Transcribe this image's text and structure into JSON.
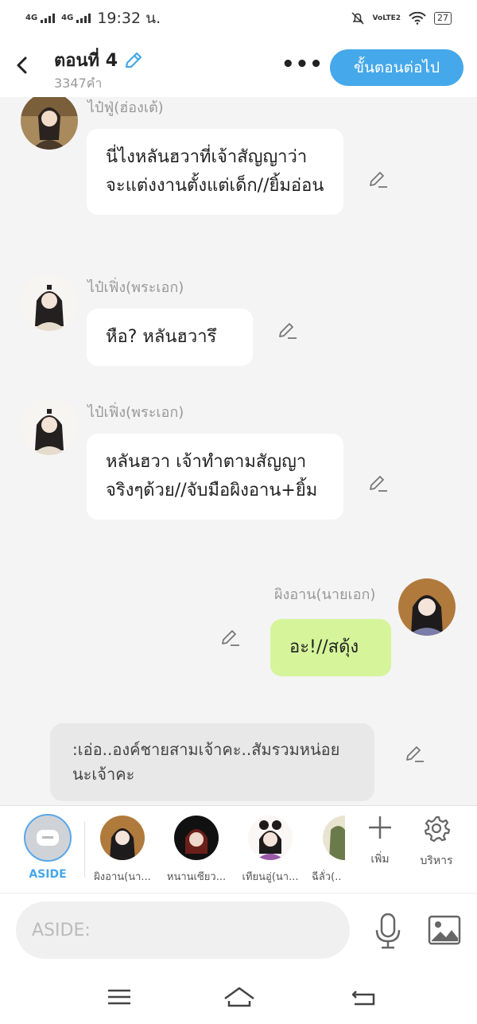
{
  "status_bar": {
    "net1": "4G",
    "net2": "4G",
    "time": "19:32 น.",
    "volte": "VoLTE2",
    "battery": "27"
  },
  "header": {
    "back_icon": "chevron-left-icon",
    "title": "ตอนที่ 4",
    "word_count": "3347คำ",
    "next_button": "ขั้นตอนต่อไป",
    "accent_color": "#45a8ea"
  },
  "messages": [
    {
      "sender": "ไป๋ฟู่(ฮ่องเต้)",
      "text": "นี่ไงหลันฮวาที่เจ้าสัญญาว่าจะแต่งงานตั้งแต่เด็ก//ยิ้มอ่อน",
      "side": "left"
    },
    {
      "sender": "ไป๋เฟิ่ง(พระเอก)",
      "text": "หือ? หลันฮวารึ",
      "side": "left"
    },
    {
      "sender": "ไป๋เฟิ่ง(พระเอก)",
      "text": "หลันฮวา เจ้าทำตามสัญญาจริงๆด้วย//จับมือผิงอาน+ยิ้ม",
      "side": "left"
    },
    {
      "sender": "ผิงอาน(นายเอก)",
      "text": "อะ!//สดุ้ง",
      "side": "right",
      "bubble_color": "#d6f59a"
    },
    {
      "sender": "",
      "text": ":เอ่อ..องค์ชายสามเจ้าคะ..สัมรวมหน่อยนะเจ้าคะ",
      "side": "aside"
    }
  ],
  "characters": {
    "aside_label": "ASIDE",
    "items": [
      {
        "name": "ผิงอาน(นา..."
      },
      {
        "name": "หนานเซียว..."
      },
      {
        "name": "เทียนอู่(นา..."
      },
      {
        "name": "ฉีลั่ว(..."
      }
    ],
    "add_label": "เพิ่ม",
    "manage_label": "บริหาร"
  },
  "input": {
    "placeholder": "ASIDE:"
  },
  "nav": {
    "menu_icon": "menu-icon",
    "home_icon": "home-icon",
    "back_icon": "back-icon"
  }
}
